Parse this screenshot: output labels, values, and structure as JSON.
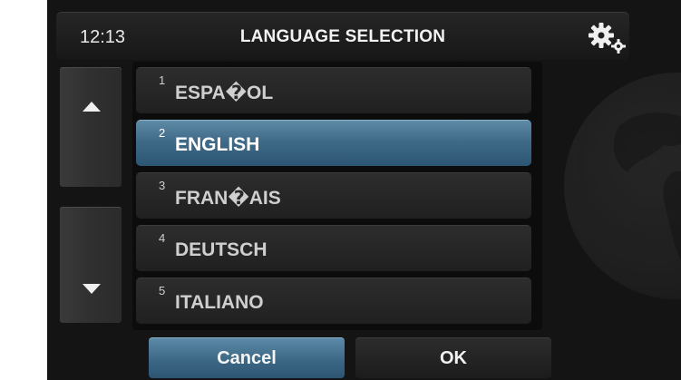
{
  "header": {
    "time": "12:13",
    "title": "LANGUAGE SELECTION",
    "settings_icon": "gear-icon"
  },
  "scroll": {
    "up_icon": "arrow-up-icon",
    "down_icon": "arrow-down-icon"
  },
  "languages": [
    {
      "num": "1",
      "label": "ESPA�OL",
      "selected": false
    },
    {
      "num": "2",
      "label": "ENGLISH",
      "selected": true
    },
    {
      "num": "3",
      "label": "FRAN�AIS",
      "selected": false
    },
    {
      "num": "4",
      "label": "DEUTSCH",
      "selected": false
    },
    {
      "num": "5",
      "label": "ITALIANO",
      "selected": false
    }
  ],
  "buttons": {
    "cancel": "Cancel",
    "ok": "OK"
  },
  "colors": {
    "background": "#141414",
    "accent": "#3f6a88",
    "text": "#f2f2f2"
  }
}
